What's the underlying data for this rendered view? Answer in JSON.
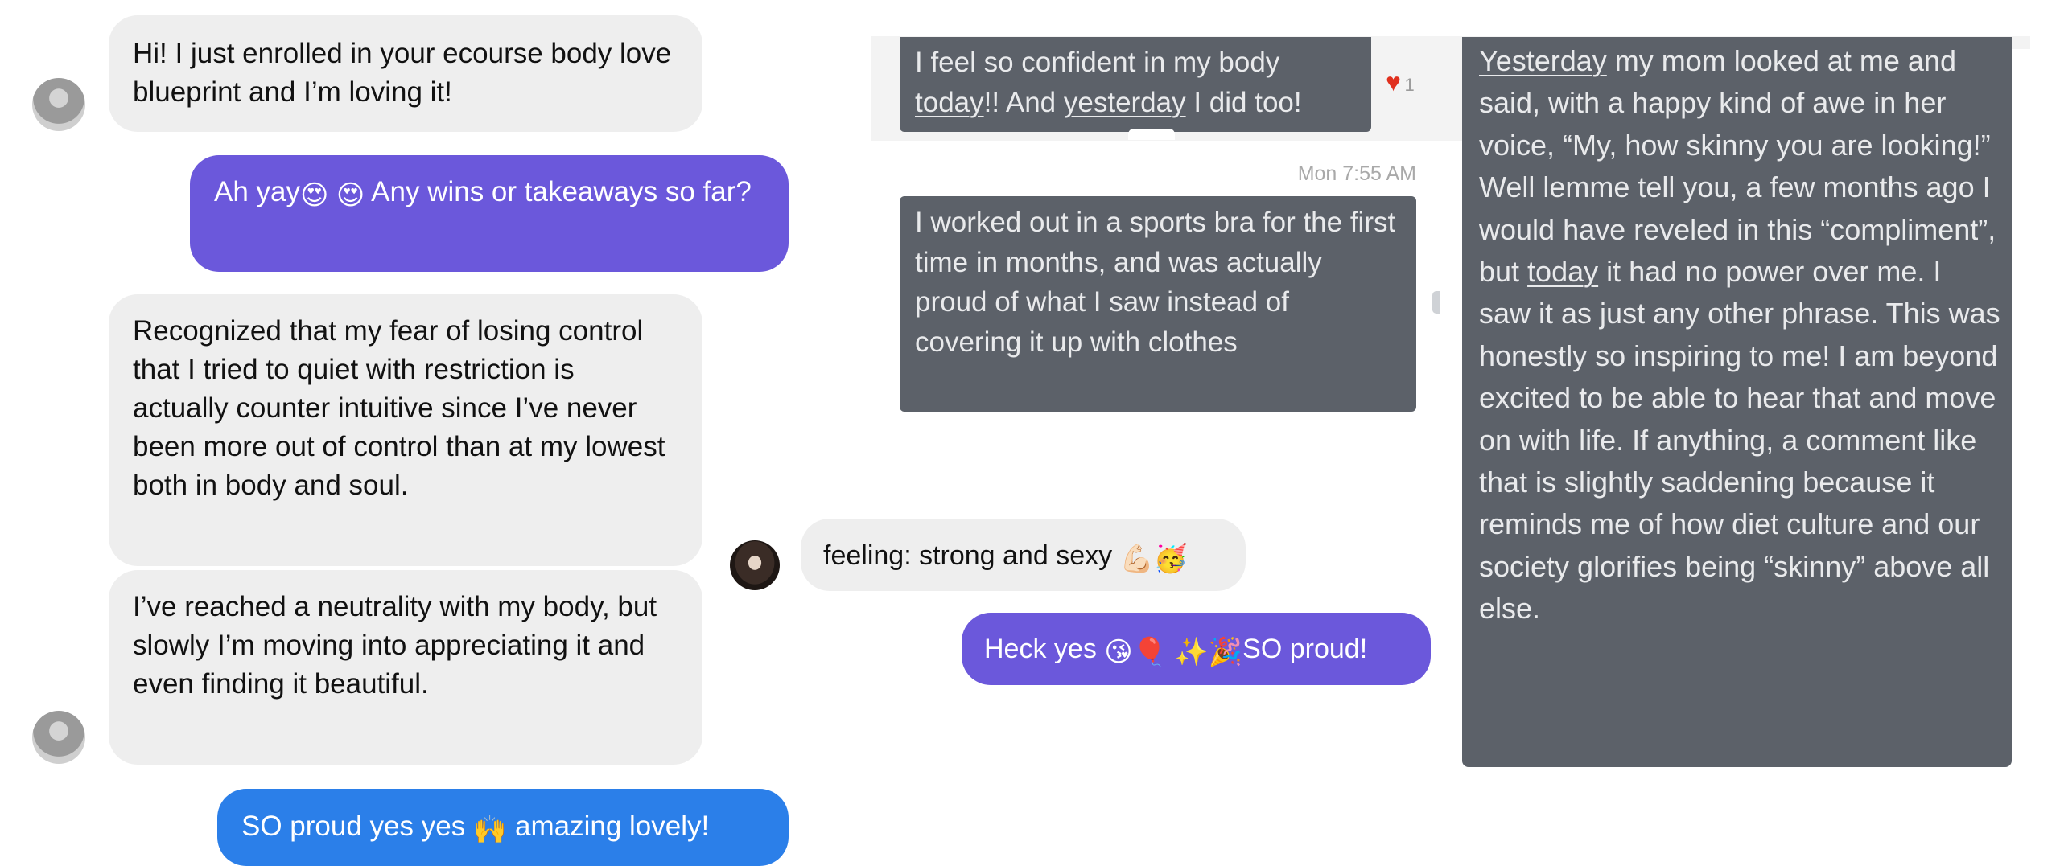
{
  "left_chat": {
    "m1": "Hi! I just enrolled in your ecourse body love blueprint and I’m loving it!",
    "m2_before": "Ah yay",
    "m2_after": " Any wins or takeaways so far?",
    "m2_emojis": "😍 😍",
    "m3": "Recognized that my fear of losing control that I tried to quiet with restriction is actually counter intuitive since I’ve never been more out of control than at my lowest both in body and soul.",
    "m4": "I’ve reached a neutrality with my body, but slowly I’m moving into appreciating it and even finding it beautiful.",
    "m5_before": "SO proud yes yes ",
    "m5_emoji": "🙌",
    "m5_after": " amazing lovely!"
  },
  "middle_chat": {
    "m1_line1": "I feel so confident in my body",
    "m1_today": "today",
    "m1_mid": "!! And ",
    "m1_yesterday": "yesterday",
    "m1_end": " I did too!",
    "reaction_count": "1",
    "timestamp": "Mon 7:55 AM",
    "m2": "I worked out in a sports bra for the first time in months, and was actually proud of what I saw instead of covering it up with clothes",
    "m3_text": "feeling: strong and sexy ",
    "m3_emojis": "💪🏻🥳",
    "m4_before": "Heck yes ",
    "m4_emojis": "😘🎈 ✨🎉",
    "m4_after": "SO proud!"
  },
  "right_chat": {
    "p1": "Yesterday",
    "p2": " my mom looked at me and said, with a happy kind of awe in her voice, “My, how skinny you are looking!” Well lemme tell you, a few months ago I would have reveled in this “compliment”, but ",
    "p3": "today",
    "p4": " it had no power over me. I saw it as just any other phrase. This was honestly so inspiring to me! I am beyond excited to be able to hear that and move on with life. If anything, a comment like that is slightly saddening because it reminds me of how diet culture and our society glorifies being “skinny” above all else."
  },
  "colors": {
    "incoming_bubble": "#eeeeee",
    "purple_bubble": "#6b58db",
    "blue_bubble": "#2b7fe9",
    "dark_bubble": "#5c6169",
    "heart": "#e0301e"
  },
  "icons": [
    "avatar",
    "heart-icon"
  ]
}
